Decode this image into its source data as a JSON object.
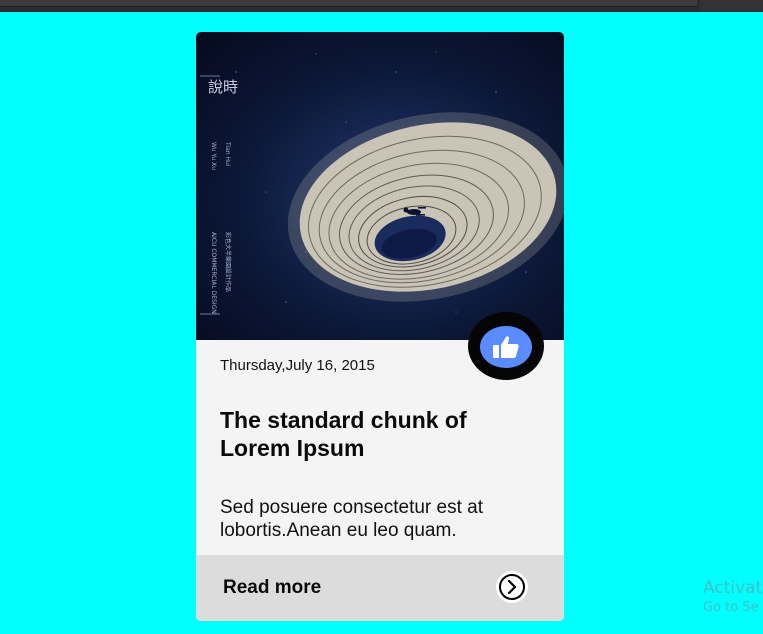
{
  "card": {
    "date": "Thursday,July 16, 2015",
    "title": "The standard chunk of Lorem Ipsum",
    "description": "Sed posuere consectetur est at lobortis.Anean eu leo quam.",
    "read_more_label": "Read more",
    "hero_image": {
      "cjk_title": "說時",
      "side_text_1": "Wu Yu Xu",
      "side_text_2": "Tian Hui",
      "side_text_3": "AICU COMMERCIAL DESIGN",
      "side_text_4": "彩色大半樂園設計作品"
    }
  },
  "watermark": {
    "line1": "Activat",
    "line2": "Go to Se"
  },
  "colors": {
    "background": "#00ffff",
    "card": "#f4f4f4",
    "footer": "#dcdcdc",
    "like_button": "#5b8cff",
    "like_ring": "#050505"
  },
  "icons": {
    "like": "thumbs-up-icon",
    "read_more": "chevron-right-circle-icon"
  }
}
